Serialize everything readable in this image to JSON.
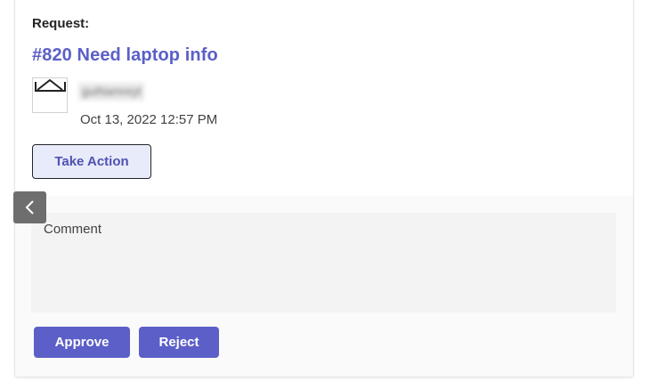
{
  "request": {
    "label": "Request:",
    "title": "#820 Need laptop info",
    "author_name": "guiNamreyt",
    "timestamp": "Oct 13, 2022 12:57 PM"
  },
  "actions": {
    "take_action_label": "Take Action"
  },
  "comment": {
    "placeholder": "Comment",
    "value": ""
  },
  "buttons": {
    "approve_label": "Approve",
    "reject_label": "Reject"
  },
  "icons": {
    "avatar": "broken-image-icon",
    "back": "chevron-left-icon"
  },
  "colors": {
    "accent": "#5b5fc7",
    "take_action_bg": "#e8ebfa",
    "back_button_bg": "#6e6e6e"
  }
}
